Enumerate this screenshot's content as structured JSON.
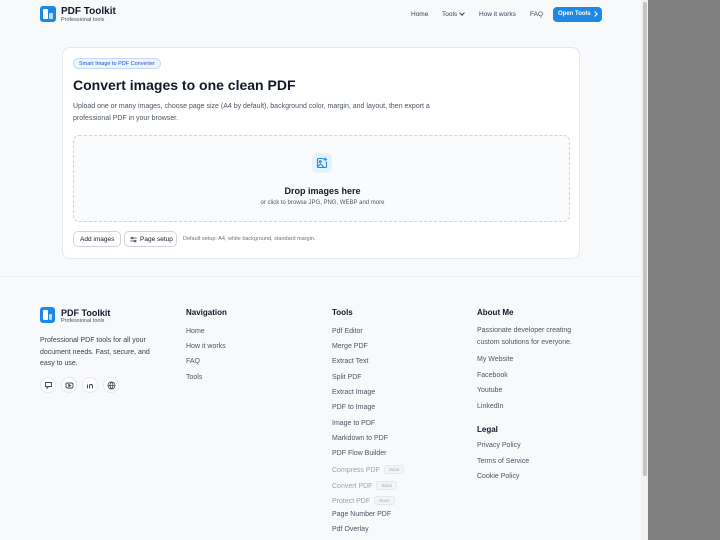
{
  "header": {
    "brand": "PDF Toolkit",
    "tagline": "Professional tools",
    "nav": [
      "Home",
      "Tools",
      "How it works",
      "FAQ"
    ],
    "cta": "Open Tools"
  },
  "converter": {
    "badge": "Smart Image to PDF Converter",
    "title": "Convert images to one clean PDF",
    "description": "Upload one or many images, choose page size (A4 by default), background color, margin, and layout, then export a professional PDF in your browser.",
    "drop_title": "Drop images here",
    "drop_subtitle": "or click to browse JPG, PNG, WEBP and more",
    "add_images": "Add images",
    "page_setup": "Page setup",
    "setup_hint": "Default setup: A4, white background, standard margin."
  },
  "footer": {
    "brand": "PDF Toolkit",
    "tagline": "Professional tools",
    "about": "Professional PDF tools for all your document needs. Fast, secure, and easy to use.",
    "social_icons": [
      "code-icon",
      "youtube-icon",
      "linkedin-icon",
      "globe-icon"
    ],
    "navigation": {
      "heading": "Navigation",
      "links": [
        "Home",
        "How it works",
        "FAQ",
        "Tools"
      ]
    },
    "tools": {
      "heading": "Tools",
      "items": [
        {
          "label": "Pdf Editor"
        },
        {
          "label": "Merge PDF"
        },
        {
          "label": "Extract Text"
        },
        {
          "label": "Split PDF"
        },
        {
          "label": "Extract Image"
        },
        {
          "label": "PDF to Image"
        },
        {
          "label": "Image to PDF"
        },
        {
          "label": "Markdown to PDF"
        },
        {
          "label": "PDF Flow Builder"
        },
        {
          "label": "Compress PDF",
          "badge": "Soon"
        },
        {
          "label": "Convert PDF",
          "badge": "Soon"
        },
        {
          "label": "Protect PDF",
          "badge": "Soon"
        },
        {
          "label": "Page Number PDF"
        },
        {
          "label": "Pdf Overlay"
        }
      ]
    },
    "about_me": {
      "heading": "About Me",
      "text": "Passionate developer creating custom solutions for everyone.",
      "links": [
        "My Website",
        "Facebook",
        "Youtube",
        "LinkedIn"
      ]
    },
    "legal": {
      "heading": "Legal",
      "links": [
        "Privacy Policy",
        "Terms of Service",
        "Cookie Policy"
      ]
    }
  },
  "colors": {
    "accent": "#1e88e5",
    "background": "#f8f9fb",
    "side_panel": "#808080"
  }
}
